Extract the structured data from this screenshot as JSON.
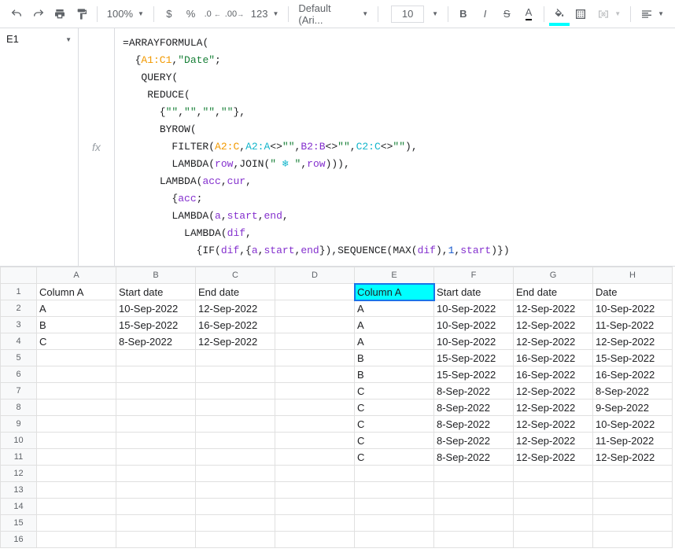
{
  "toolbar": {
    "zoom": "100%",
    "currency": "$",
    "percent": "%",
    "dec_dec": ".0",
    "inc_dec": ".00",
    "num_fmt": "123",
    "font_name": "Default (Ari...",
    "font_size": "10",
    "bold": "B",
    "italic": "I",
    "strike": "S",
    "text_color": "A"
  },
  "namebox": "E1",
  "fx_label": "fx",
  "formula_lines": [
    [
      {
        "t": "=",
        "c": ""
      },
      {
        "t": "ARRAYFORMULA",
        "c": "tok-fn"
      },
      {
        "t": "(",
        "c": ""
      }
    ],
    [
      {
        "t": "  {",
        "c": ""
      },
      {
        "t": "A1:C1",
        "c": "tok-range"
      },
      {
        "t": ",",
        "c": ""
      },
      {
        "t": "\"Date\"",
        "c": "tok-str"
      },
      {
        "t": ";",
        "c": ""
      }
    ],
    [
      {
        "t": "   ",
        "c": ""
      },
      {
        "t": "QUERY",
        "c": "tok-fn"
      },
      {
        "t": "(",
        "c": ""
      }
    ],
    [
      {
        "t": "    ",
        "c": ""
      },
      {
        "t": "REDUCE",
        "c": "tok-fn"
      },
      {
        "t": "(",
        "c": ""
      }
    ],
    [
      {
        "t": "      {",
        "c": ""
      },
      {
        "t": "\"\"",
        "c": "tok-str"
      },
      {
        "t": ",",
        "c": ""
      },
      {
        "t": "\"\"",
        "c": "tok-str"
      },
      {
        "t": ",",
        "c": ""
      },
      {
        "t": "\"\"",
        "c": "tok-str"
      },
      {
        "t": ",",
        "c": ""
      },
      {
        "t": "\"\"",
        "c": "tok-str"
      },
      {
        "t": "},",
        "c": ""
      }
    ],
    [
      {
        "t": "      ",
        "c": ""
      },
      {
        "t": "BYROW",
        "c": "tok-fn"
      },
      {
        "t": "(",
        "c": ""
      }
    ],
    [
      {
        "t": "        ",
        "c": ""
      },
      {
        "t": "FILTER",
        "c": "tok-fn"
      },
      {
        "t": "(",
        "c": ""
      },
      {
        "t": "A2:C",
        "c": "tok-range"
      },
      {
        "t": ",",
        "c": ""
      },
      {
        "t": "A2:A",
        "c": "tok-cyan"
      },
      {
        "t": "<>",
        "c": ""
      },
      {
        "t": "\"\"",
        "c": "tok-str"
      },
      {
        "t": ",",
        "c": ""
      },
      {
        "t": "B2:B",
        "c": "tok-lambda"
      },
      {
        "t": "<>",
        "c": ""
      },
      {
        "t": "\"\"",
        "c": "tok-str"
      },
      {
        "t": ",",
        "c": ""
      },
      {
        "t": "C2:C",
        "c": "tok-cyan"
      },
      {
        "t": "<>",
        "c": ""
      },
      {
        "t": "\"\"",
        "c": "tok-str"
      },
      {
        "t": "),",
        "c": ""
      }
    ],
    [
      {
        "t": "        ",
        "c": ""
      },
      {
        "t": "LAMBDA",
        "c": "tok-fn"
      },
      {
        "t": "(",
        "c": ""
      },
      {
        "t": "row",
        "c": "tok-var"
      },
      {
        "t": ",",
        "c": ""
      },
      {
        "t": "JOIN",
        "c": "tok-fn"
      },
      {
        "t": "(",
        "c": ""
      },
      {
        "t": "\" ",
        "c": "tok-str"
      },
      {
        "t": "❄",
        "c": "snow"
      },
      {
        "t": " \"",
        "c": "tok-str"
      },
      {
        "t": ",",
        "c": ""
      },
      {
        "t": "row",
        "c": "tok-var"
      },
      {
        "t": "))),",
        "c": ""
      }
    ],
    [
      {
        "t": "      ",
        "c": ""
      },
      {
        "t": "LAMBDA",
        "c": "tok-fn"
      },
      {
        "t": "(",
        "c": ""
      },
      {
        "t": "acc",
        "c": "tok-var"
      },
      {
        "t": ",",
        "c": ""
      },
      {
        "t": "cur",
        "c": "tok-var"
      },
      {
        "t": ",",
        "c": ""
      }
    ],
    [
      {
        "t": "        {",
        "c": ""
      },
      {
        "t": "acc",
        "c": "tok-var"
      },
      {
        "t": ";",
        "c": ""
      }
    ],
    [
      {
        "t": "        ",
        "c": ""
      },
      {
        "t": "LAMBDA",
        "c": "tok-fn"
      },
      {
        "t": "(",
        "c": ""
      },
      {
        "t": "a",
        "c": "tok-var"
      },
      {
        "t": ",",
        "c": ""
      },
      {
        "t": "start",
        "c": "tok-var"
      },
      {
        "t": ",",
        "c": ""
      },
      {
        "t": "end",
        "c": "tok-var"
      },
      {
        "t": ",",
        "c": ""
      }
    ],
    [
      {
        "t": "          ",
        "c": ""
      },
      {
        "t": "LAMBDA",
        "c": "tok-fn"
      },
      {
        "t": "(",
        "c": ""
      },
      {
        "t": "dif",
        "c": "tok-var"
      },
      {
        "t": ",",
        "c": ""
      }
    ],
    [
      {
        "t": "            {",
        "c": ""
      },
      {
        "t": "IF",
        "c": "tok-fn"
      },
      {
        "t": "(",
        "c": ""
      },
      {
        "t": "dif",
        "c": "tok-var"
      },
      {
        "t": ",{",
        "c": ""
      },
      {
        "t": "a",
        "c": "tok-var"
      },
      {
        "t": ",",
        "c": ""
      },
      {
        "t": "start",
        "c": "tok-var"
      },
      {
        "t": ",",
        "c": ""
      },
      {
        "t": "end",
        "c": "tok-var"
      },
      {
        "t": "}),",
        "c": ""
      },
      {
        "t": "SEQUENCE",
        "c": "tok-fn"
      },
      {
        "t": "(",
        "c": ""
      },
      {
        "t": "MAX",
        "c": "tok-fn"
      },
      {
        "t": "(",
        "c": ""
      },
      {
        "t": "dif",
        "c": "tok-var"
      },
      {
        "t": "),",
        "c": ""
      },
      {
        "t": "1",
        "c": "tok-num"
      },
      {
        "t": ",",
        "c": ""
      },
      {
        "t": "start",
        "c": "tok-var"
      },
      {
        "t": ")})",
        "c": ""
      }
    ]
  ],
  "columns": [
    "A",
    "B",
    "C",
    "D",
    "E",
    "F",
    "G",
    "H"
  ],
  "row_count": 16,
  "cells": {
    "A1": "Column A",
    "B1": "Start date",
    "C1": "End date",
    "E1": "Column A",
    "F1": "Start date",
    "G1": "End date",
    "H1": "Date",
    "A2": "A",
    "B2": "10-Sep-2022",
    "C2": "12-Sep-2022",
    "E2": "A",
    "F2": "10-Sep-2022",
    "G2": "12-Sep-2022",
    "H2": "10-Sep-2022",
    "A3": "B",
    "B3": "15-Sep-2022",
    "C3": "16-Sep-2022",
    "E3": "A",
    "F3": "10-Sep-2022",
    "G3": "12-Sep-2022",
    "H3": "11-Sep-2022",
    "A4": "C",
    "B4": "8-Sep-2022",
    "C4": "12-Sep-2022",
    "E4": "A",
    "F4": "10-Sep-2022",
    "G4": "12-Sep-2022",
    "H4": "12-Sep-2022",
    "E5": "B",
    "F5": "15-Sep-2022",
    "G5": "16-Sep-2022",
    "H5": "15-Sep-2022",
    "E6": "B",
    "F6": "15-Sep-2022",
    "G6": "16-Sep-2022",
    "H6": "16-Sep-2022",
    "E7": "C",
    "F7": "8-Sep-2022",
    "G7": "12-Sep-2022",
    "H7": "8-Sep-2022",
    "E8": "C",
    "F8": "8-Sep-2022",
    "G8": "12-Sep-2022",
    "H8": "9-Sep-2022",
    "E9": "C",
    "F9": "8-Sep-2022",
    "G9": "12-Sep-2022",
    "H9": "10-Sep-2022",
    "E10": "C",
    "F10": "8-Sep-2022",
    "G10": "12-Sep-2022",
    "H10": "11-Sep-2022",
    "E11": "C",
    "F11": "8-Sep-2022",
    "G11": "12-Sep-2022",
    "H11": "12-Sep-2022"
  },
  "active_cell": "E1"
}
